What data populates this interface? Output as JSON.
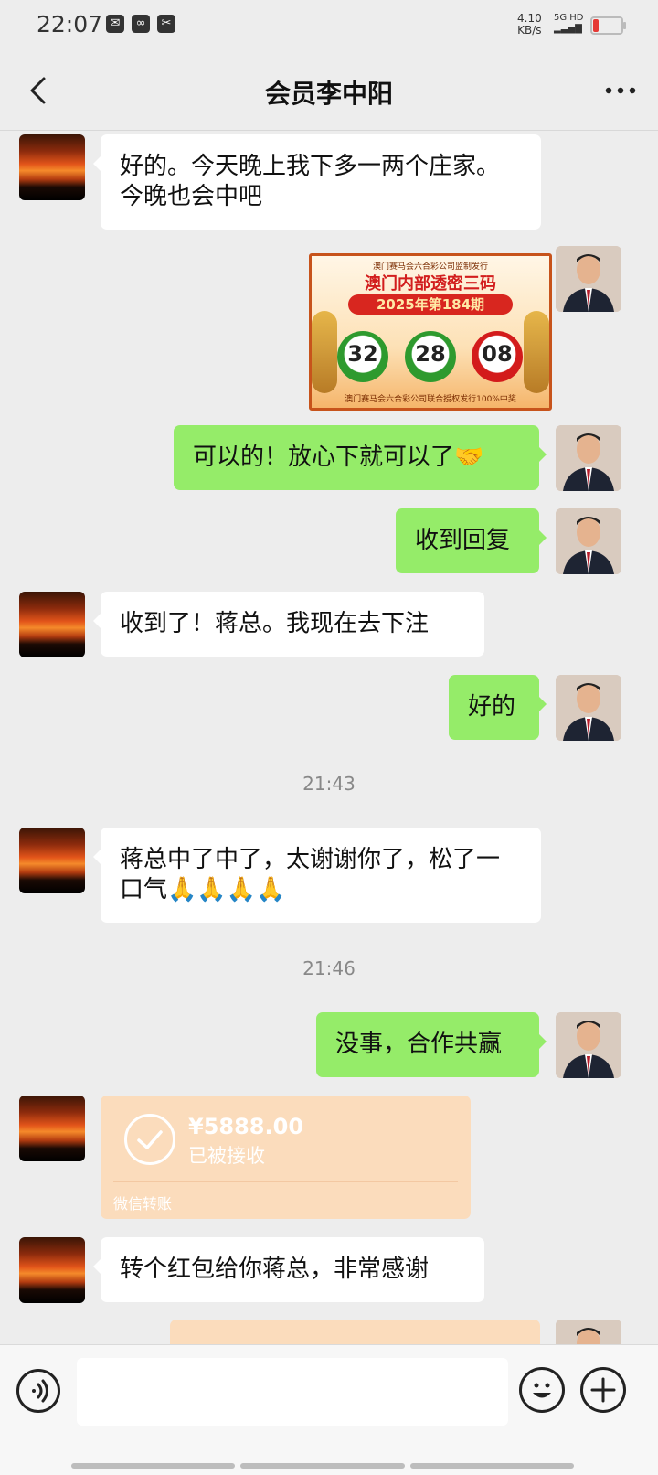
{
  "status_bar": {
    "time": "22:07",
    "speed_value": "4.10",
    "speed_unit": "KB/s",
    "network": "5G HD",
    "icons": [
      "mail-icon",
      "link-icon",
      "capcut-icon"
    ]
  },
  "header": {
    "title": "会员李中阳",
    "back_icon": "chevron-left-icon",
    "more_icon": "more-dots-icon"
  },
  "messages": [
    {
      "side": "in",
      "text": "好的。今天晚上我下多一两个庄家。今晚也会中吧"
    },
    {
      "side": "out",
      "type": "image",
      "image": {
        "top_line": "澳门赛马会六合彩公司监制发行",
        "headline": "澳门内部透密三码",
        "issue": "2025年第184期",
        "numbers": [
          "32",
          "28",
          "08"
        ],
        "number_colors": [
          "green",
          "green",
          "red"
        ],
        "footer": "澳门赛马会六合彩公司联合授权发行100%中奖"
      }
    },
    {
      "side": "out",
      "text": "可以的！放心下就可以了🤝"
    },
    {
      "side": "out",
      "text": "收到回复"
    },
    {
      "side": "in",
      "text": "收到了！蒋总。我现在去下注"
    },
    {
      "side": "out",
      "text": "好的"
    },
    {
      "type": "time",
      "text": "21:43"
    },
    {
      "side": "in",
      "text": "蒋总中了中了，太谢谢你了，松了一口气🙏🙏🙏🙏"
    },
    {
      "type": "time",
      "text": "21:46"
    },
    {
      "side": "out",
      "text": "没事，合作共赢"
    },
    {
      "side": "in",
      "type": "transfer",
      "amount": "¥5888.00",
      "status": "已被接收",
      "label": "微信转账"
    },
    {
      "side": "in",
      "text": "转个红包给你蒋总，非常感谢"
    }
  ],
  "input_bar": {
    "voice_icon": "voice-icon",
    "emoji_icon": "emoji-icon",
    "plus_icon": "plus-icon"
  },
  "colors": {
    "background": "#ededed",
    "bubble_out": "#95ec69",
    "bubble_in": "#ffffff",
    "transfer_accepted": "#fbdcbc"
  }
}
